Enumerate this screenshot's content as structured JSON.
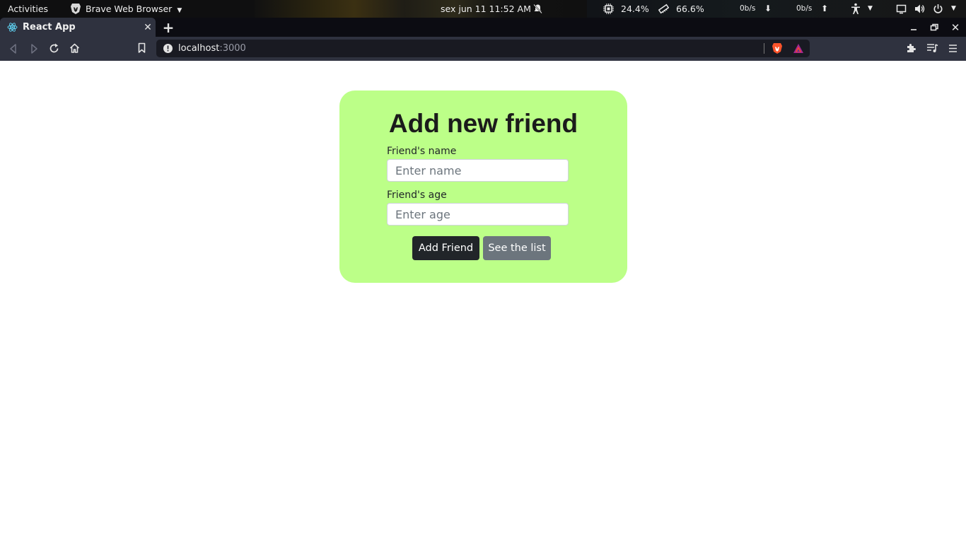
{
  "system_bar": {
    "activities": "Activities",
    "app_name": "Brave Web Browser",
    "datetime": "sex jun 11  11:52 AM",
    "cpu": "24.4%",
    "memory": "66.6%",
    "net_down": "0b/s",
    "net_up": "0b/s"
  },
  "browser": {
    "tab_title": "React App",
    "url_host": "localhost",
    "url_port": ":3000"
  },
  "form": {
    "title": "Add new friend",
    "name_label": "Friend's name",
    "name_placeholder": "Enter name",
    "name_value": "",
    "age_label": "Friend's age",
    "age_placeholder": "Enter age",
    "age_value": "",
    "add_button": "Add Friend",
    "list_button": "See the list"
  },
  "colors": {
    "card_bg": "#bcff88",
    "add_button_bg": "#212529",
    "list_button_bg": "#6c757d"
  }
}
